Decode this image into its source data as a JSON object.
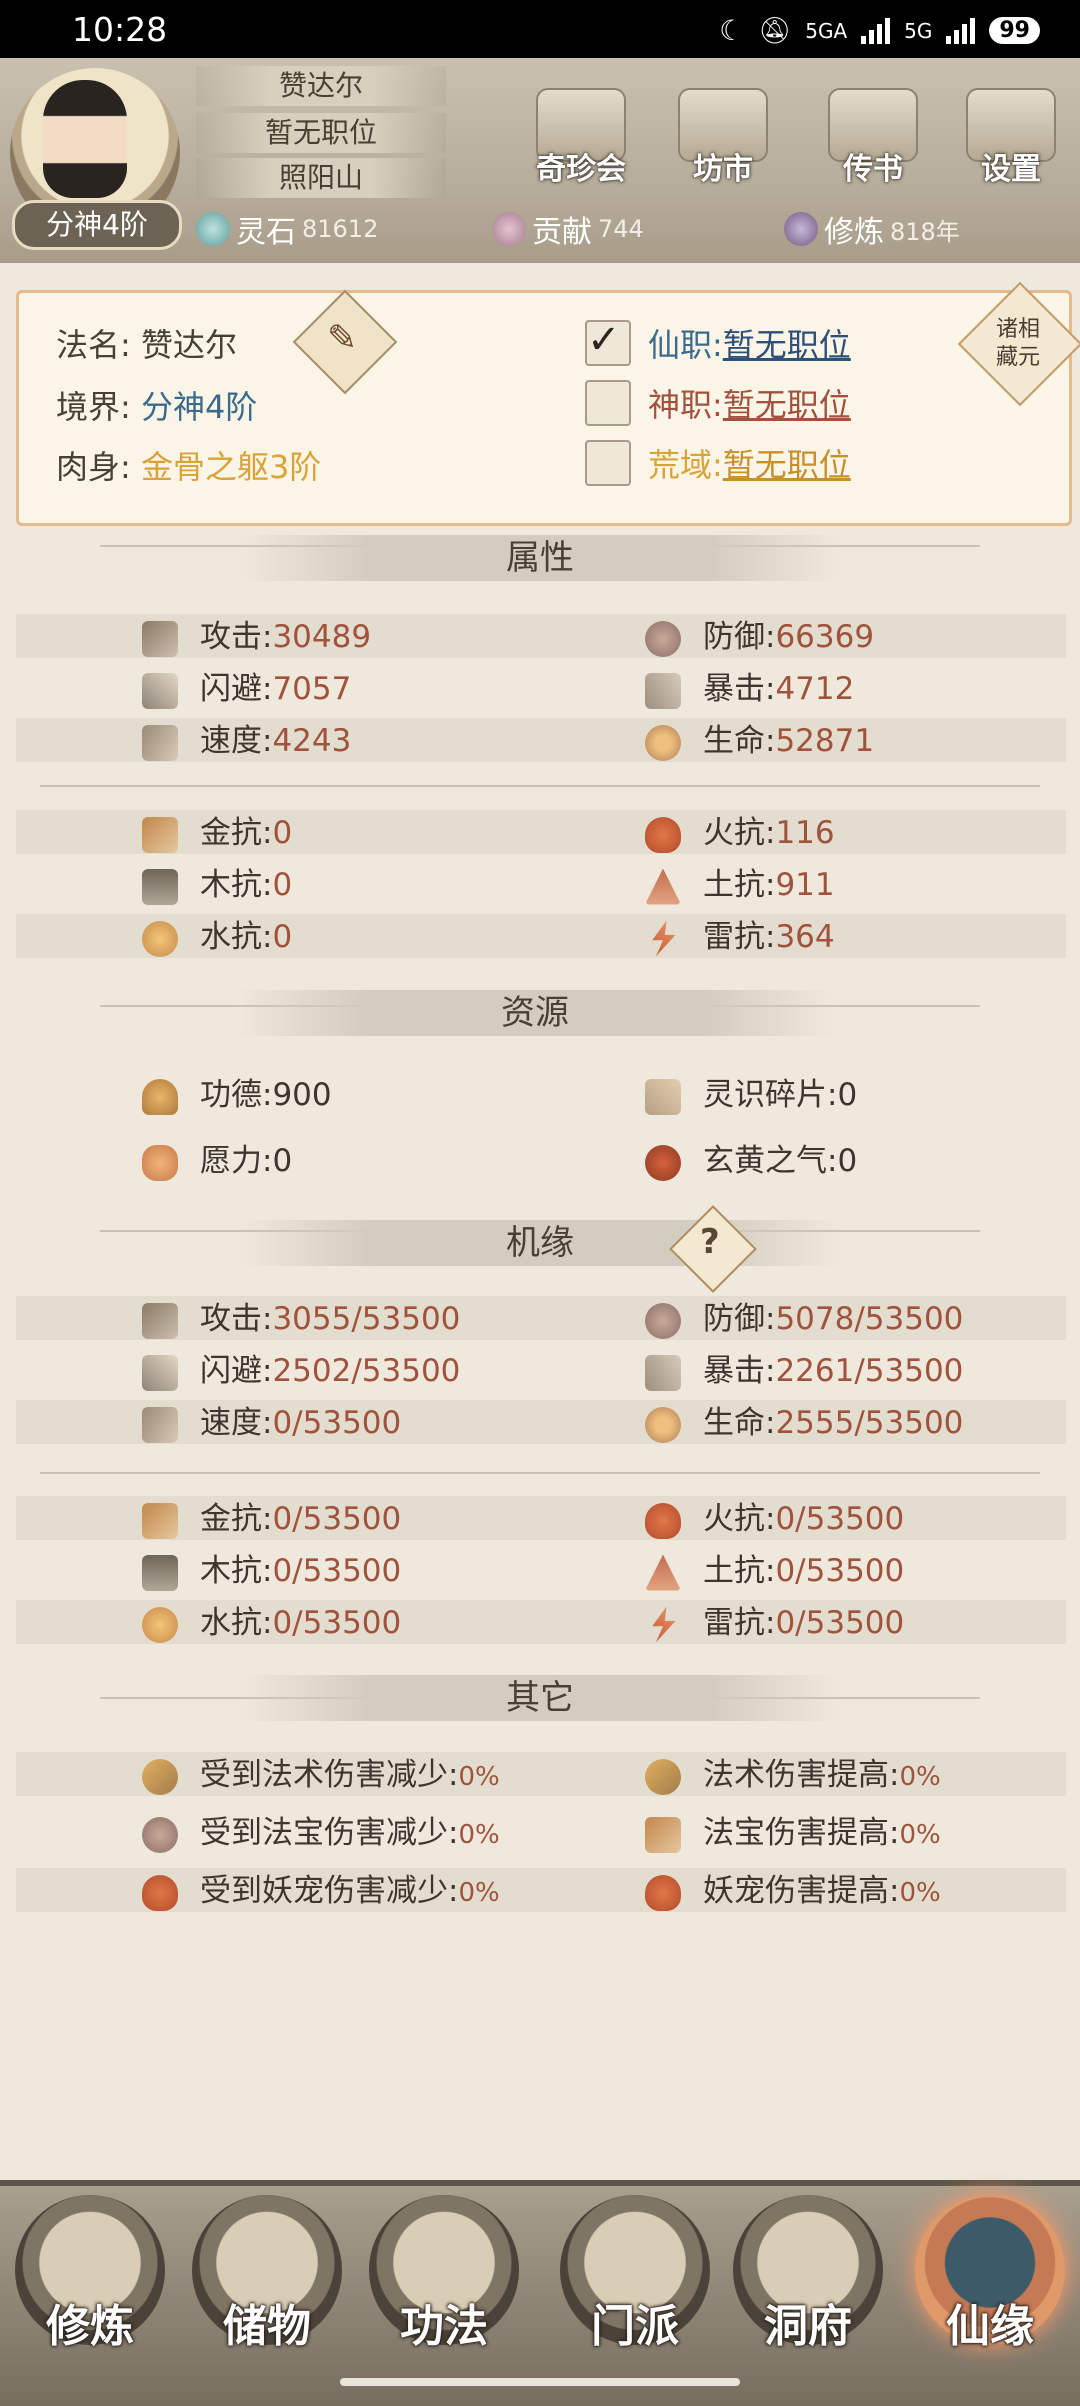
{
  "status_bar": {
    "time": "10:28",
    "network_1": "5GA",
    "network_2": "5G",
    "battery": "99"
  },
  "header": {
    "realm_badge": "分神4阶",
    "name": "赞达尔",
    "title": "暂无职位",
    "location": "照阳山",
    "buttons": [
      {
        "label": "奇珍会",
        "icon": "pavilion-icon"
      },
      {
        "label": "坊市",
        "icon": "market-icon"
      },
      {
        "label": "传书",
        "icon": "scroll-icon"
      },
      {
        "label": "设置",
        "icon": "gear-icon"
      }
    ],
    "resources": [
      {
        "label": "灵石",
        "value": "81612"
      },
      {
        "label": "贡献",
        "value": "744"
      },
      {
        "label": "修炼",
        "value": "818年"
      }
    ]
  },
  "profile": {
    "dharma_name_label": "法名:",
    "dharma_name": "赞达尔",
    "realm_label": "境界:",
    "realm": "分神4阶",
    "body_label": "肉身:",
    "body": "金骨之躯3阶",
    "posts": [
      {
        "label": "仙职:",
        "value": "暂无职位",
        "checked": true
      },
      {
        "label": "神职:",
        "value": "暂无职位",
        "checked": false
      },
      {
        "label": "荒域:",
        "value": "暂无职位",
        "checked": false
      }
    ],
    "collection_button": "诸相藏元"
  },
  "attributes": {
    "title": "属性",
    "stats": [
      {
        "name": "攻击:",
        "value": "30489"
      },
      {
        "name": "防御:",
        "value": "66369"
      },
      {
        "name": "闪避:",
        "value": "7057"
      },
      {
        "name": "暴击:",
        "value": "4712"
      },
      {
        "name": "速度:",
        "value": "4243"
      },
      {
        "name": "生命:",
        "value": "52871"
      }
    ],
    "resists": [
      {
        "name": "金抗:",
        "value": "0"
      },
      {
        "name": "火抗:",
        "value": "116"
      },
      {
        "name": "木抗:",
        "value": "0"
      },
      {
        "name": "土抗:",
        "value": "911"
      },
      {
        "name": "水抗:",
        "value": "0"
      },
      {
        "name": "雷抗:",
        "value": "364"
      }
    ]
  },
  "resources": {
    "title": "资源",
    "items": [
      {
        "name": "功德:",
        "value": "900"
      },
      {
        "name": "灵识碎片:",
        "value": "0"
      },
      {
        "name": "愿力:",
        "value": "0"
      },
      {
        "name": "玄黄之气:",
        "value": "0"
      }
    ]
  },
  "fortune": {
    "title": "机缘",
    "help": "?",
    "stats": [
      {
        "name": "攻击:",
        "value": "3055/53500"
      },
      {
        "name": "防御:",
        "value": "5078/53500"
      },
      {
        "name": "闪避:",
        "value": "2502/53500"
      },
      {
        "name": "暴击:",
        "value": "2261/53500"
      },
      {
        "name": "速度:",
        "value": "0/53500"
      },
      {
        "name": "生命:",
        "value": "2555/53500"
      }
    ],
    "resists": [
      {
        "name": "金抗:",
        "value": "0/53500"
      },
      {
        "name": "火抗:",
        "value": "0/53500"
      },
      {
        "name": "木抗:",
        "value": "0/53500"
      },
      {
        "name": "土抗:",
        "value": "0/53500"
      },
      {
        "name": "水抗:",
        "value": "0/53500"
      },
      {
        "name": "雷抗:",
        "value": "0/53500"
      }
    ]
  },
  "other": {
    "title": "其它",
    "items": [
      {
        "name": "受到法术伤害减少:",
        "value": "0%"
      },
      {
        "name": "法术伤害提高:",
        "value": "0%"
      },
      {
        "name": "受到法宝伤害减少:",
        "value": "0%"
      },
      {
        "name": "法宝伤害提高:",
        "value": "0%"
      },
      {
        "name": "受到妖宠伤害减少:",
        "value": "0%"
      },
      {
        "name": "妖宠伤害提高:",
        "value": "0%"
      }
    ]
  },
  "bottom_nav": [
    {
      "label": "修炼",
      "active": false
    },
    {
      "label": "储物",
      "active": false
    },
    {
      "label": "功法",
      "active": false
    },
    {
      "label": "门派",
      "active": false
    },
    {
      "label": "洞府",
      "active": false
    },
    {
      "label": "仙缘",
      "active": true
    }
  ],
  "colors": {
    "accent_link": "#2e4f78",
    "value_red": "#a0523c",
    "gold": "#d9a338",
    "panel_border": "#e7b98c"
  }
}
